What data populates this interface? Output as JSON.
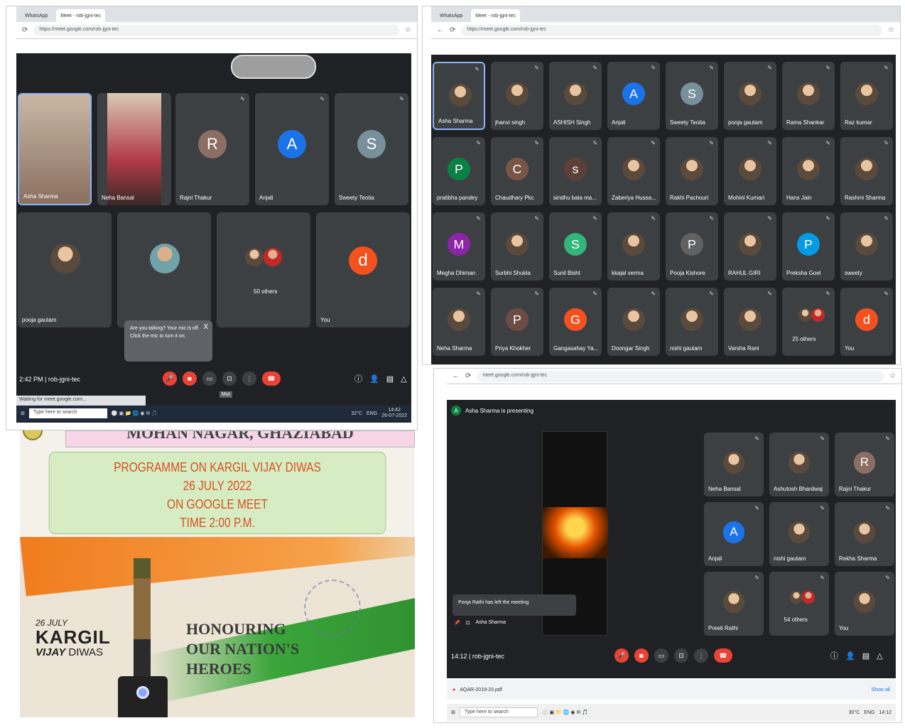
{
  "q1": {
    "tabs": [
      "WhatsApp",
      "Meet - rob-jgni-tec"
    ],
    "url": "https://meet.google.com/rob-jgni-tec",
    "top_tiles": [
      {
        "name": "Asha Sharma",
        "kind": "photo"
      },
      {
        "name": "Neha Bansal",
        "kind": "photo"
      },
      {
        "name": "Rajni Thakur",
        "kind": "avatar",
        "letter": "R",
        "color": "#8d6e63"
      },
      {
        "name": "Anjali",
        "kind": "avatar",
        "letter": "A",
        "color": "#1a73e8"
      },
      {
        "name": "Sweety Teotia",
        "kind": "avatar",
        "letter": "S",
        "color": "#78909c"
      }
    ],
    "bottom_tiles": [
      {
        "name": "pooja gautam"
      },
      {
        "name": ""
      },
      {
        "name": "50 others"
      },
      {
        "name": "You",
        "letter": "d",
        "color": "#f4511e"
      }
    ],
    "tooltip_line1": "Are you talking? Your mic is off.",
    "tooltip_line2": "Click the mic to turn it on.",
    "tooltip_close": "X",
    "time_code": "2:42 PM | rob-jgni-tec",
    "status_bar": "Waiting for meet.google.com...",
    "mic_tip": "Mut",
    "taskbar": {
      "search": "Type here to search",
      "weather": "32°C",
      "lang": "ENG",
      "clock": "14:42",
      "date": "26-07-2022"
    }
  },
  "q2": {
    "tabs": [
      "WhatsApp",
      "Meet - rob-jgni-tec"
    ],
    "url": "https://meet.google.com/rob-jgni-tec",
    "grid": [
      {
        "name": "Asha Sharma",
        "kind": "photo"
      },
      {
        "name": "jhanvi singh",
        "kind": "photo"
      },
      {
        "name": "ASHISH Singh",
        "kind": "photo"
      },
      {
        "name": "Anjali",
        "letter": "A",
        "color": "#1a73e8"
      },
      {
        "name": "Sweety Teotia",
        "letter": "S",
        "color": "#78909c"
      },
      {
        "name": "pooja gautam",
        "kind": "photo"
      },
      {
        "name": "Rama Shankar",
        "kind": "photo"
      },
      {
        "name": "Raz kumar",
        "kind": "photo"
      },
      {
        "name": "pratibha pandey",
        "letter": "P",
        "color": "#0b8043"
      },
      {
        "name": "Chaudhary Pkc",
        "letter": "C",
        "color": "#795548"
      },
      {
        "name": "sindhu bala ma...",
        "letter": "s",
        "color": "#5d4037"
      },
      {
        "name": "Zaberiya Hussa...",
        "kind": "photo"
      },
      {
        "name": "Rakhi Pachouri",
        "kind": "photo"
      },
      {
        "name": "Mohini Kumari",
        "kind": "photo"
      },
      {
        "name": "Hans Jain",
        "kind": "photo"
      },
      {
        "name": "Rashmi Sharma",
        "kind": "photo"
      },
      {
        "name": "Megha Dhiman",
        "letter": "M",
        "color": "#8e24aa"
      },
      {
        "name": "Surbhi Shukla",
        "kind": "photo"
      },
      {
        "name": "Sunil Bisht",
        "letter": "S",
        "color": "#33b679"
      },
      {
        "name": "kkajal verma",
        "kind": "photo"
      },
      {
        "name": "Pooja Kishore",
        "letter": "P",
        "color": "#616161"
      },
      {
        "name": "RAHUL GIRI",
        "kind": "photo"
      },
      {
        "name": "Preksha Goel",
        "letter": "P",
        "color": "#039be5"
      },
      {
        "name": "sweety",
        "kind": "photo"
      },
      {
        "name": "Neha Sharma",
        "kind": "photo"
      },
      {
        "name": "Priya Khokher",
        "letter": "P",
        "color": "#6d4c41"
      },
      {
        "name": "Gangasahay Ya...",
        "letter": "G",
        "color": "#f4511e"
      },
      {
        "name": "Doongar Singh",
        "kind": "photo"
      },
      {
        "name": "nishi gautam",
        "kind": "photo"
      },
      {
        "name": "Varsha Rani",
        "kind": "photo"
      },
      {
        "name": "25 others",
        "kind": "others"
      },
      {
        "name": "You",
        "letter": "d",
        "color": "#f4511e"
      }
    ]
  },
  "q3": {
    "header": "MOHAN NAGAR, GHAZIABAD",
    "lines": [
      "PROGRAMME ON KARGIL VIJAY DIWAS",
      "26 JULY 2022",
      "ON GOOGLE MEET",
      "TIME 2:00 P.M."
    ],
    "banner_date": "26 JULY",
    "banner_title": "KARGIL",
    "banner_sub_a": "VIJAY",
    "banner_sub_b": "DIWAS",
    "slogan": [
      "HONOURING",
      "OUR NATION'S",
      "HEROES"
    ]
  },
  "q4": {
    "url": "meet.google.com/rob-jgni-tec",
    "presenting": "Asha Sharma is presenting",
    "presenter_initial": "A",
    "tiles": [
      {
        "name": "Neha Bansal",
        "kind": "photo"
      },
      {
        "name": "Ashutosh Bhardwaj",
        "kind": "photo"
      },
      {
        "name": "Rajni Thakur",
        "letter": "R",
        "color": "#8d6e63"
      },
      {
        "name": "Anjali",
        "letter": "A",
        "color": "#1a73e8"
      },
      {
        "name": "nishi gautam",
        "kind": "photo"
      },
      {
        "name": "Rekha Sharma",
        "kind": "photo"
      },
      {
        "name": "Preeti Rathi",
        "kind": "photo"
      },
      {
        "name": "54 others",
        "kind": "others"
      },
      {
        "name": "You",
        "kind": "photo"
      }
    ],
    "toast": "Pooja Rathi has left the meeting",
    "presenter_label": "Asha Sharma",
    "time_code": "14:12 | rob-jgni-tec",
    "download": "AQAR-2019-20.pdf",
    "show_all": "Show all",
    "taskbar": {
      "search": "Type here to search",
      "weather": "30°C",
      "lang": "ENG",
      "clock": "14:12"
    }
  }
}
